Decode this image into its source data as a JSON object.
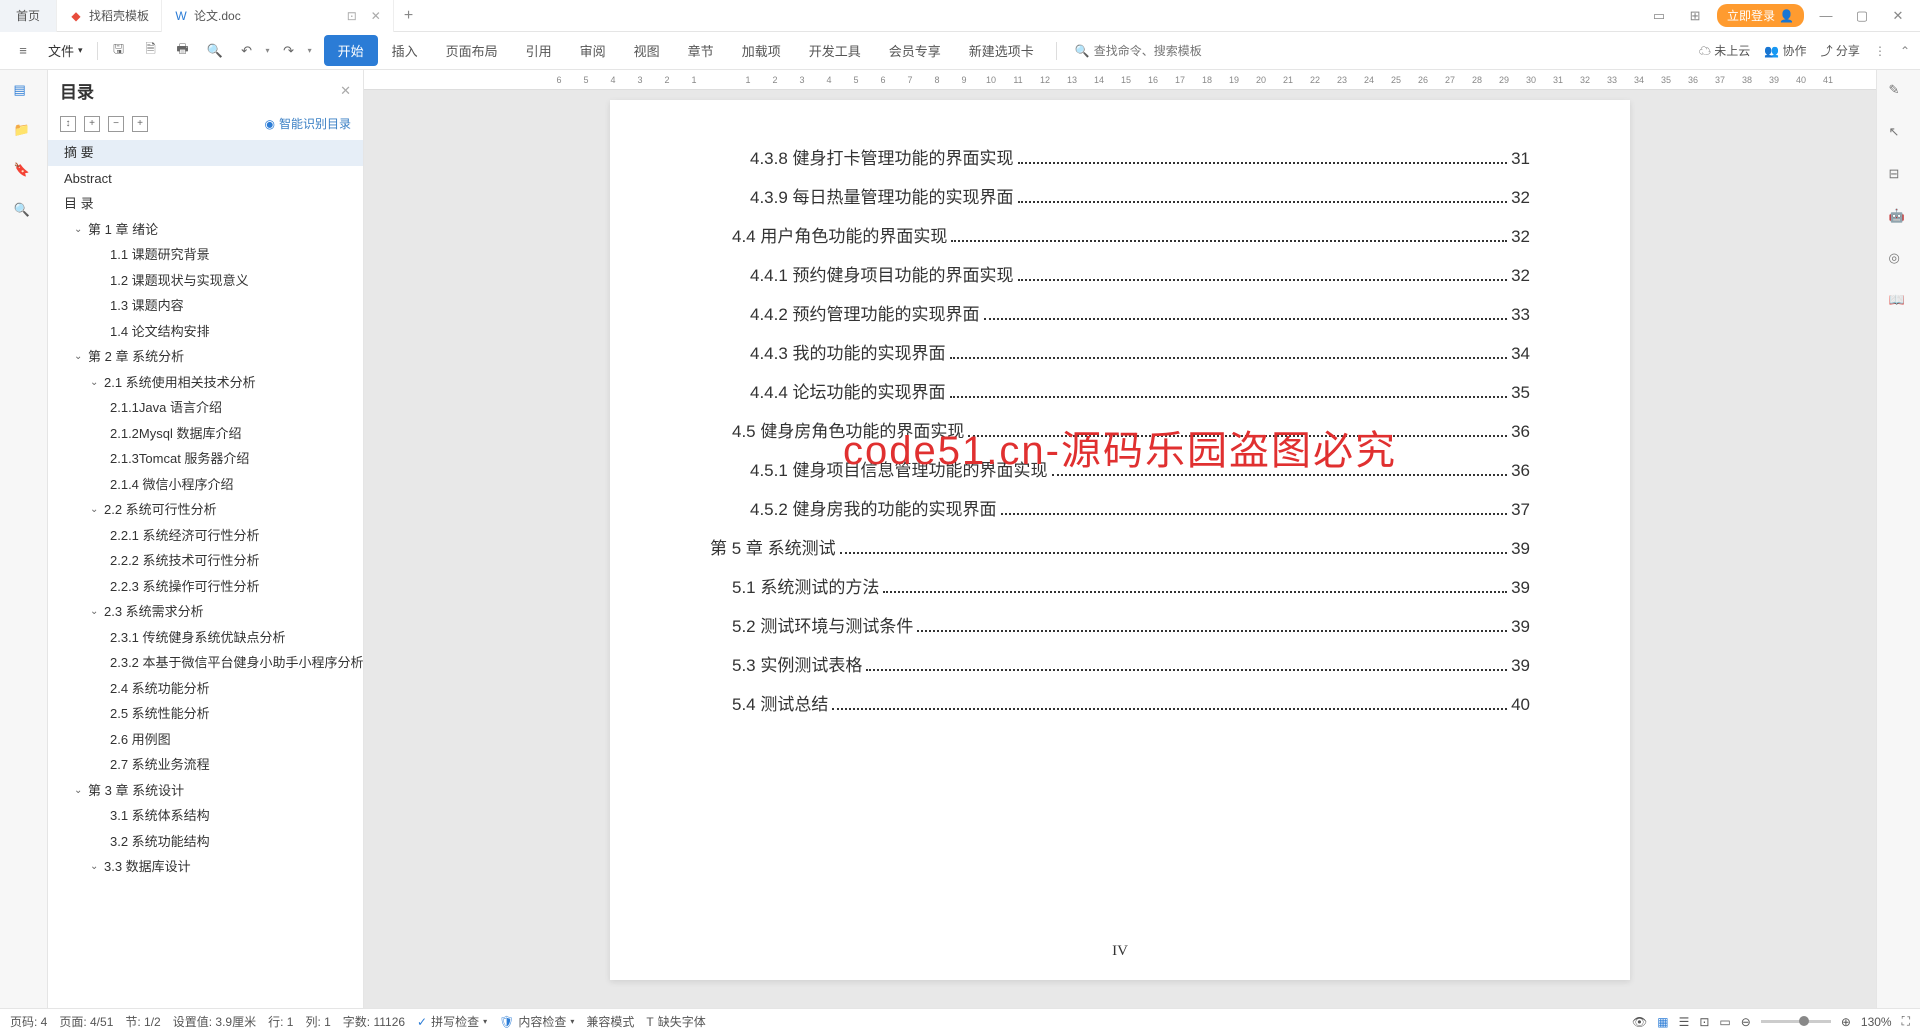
{
  "titlebar": {
    "home": "首页",
    "tab1": "找稻壳模板",
    "tab2": "论文.doc",
    "login": "立即登录"
  },
  "menu": {
    "file": "文件",
    "tabs": [
      "开始",
      "插入",
      "页面布局",
      "引用",
      "审阅",
      "视图",
      "章节",
      "加载项",
      "开发工具",
      "会员专享",
      "新建选项卡"
    ],
    "search_ph": "查找命令、搜索模板",
    "cloud": "未上云",
    "coop": "协作",
    "share": "分享"
  },
  "outline": {
    "title": "目录",
    "smart": "智能识别目录",
    "items": [
      {
        "t": "摘  要",
        "lvl": 0,
        "sel": true
      },
      {
        "t": "Abstract",
        "lvl": 0
      },
      {
        "t": "目 录",
        "lvl": 0
      },
      {
        "t": "第 1 章  绪论",
        "lvl": 1,
        "c": 1
      },
      {
        "t": "1.1 课题研究背景",
        "lvl": 3
      },
      {
        "t": "1.2 课题现状与实现意义",
        "lvl": 3
      },
      {
        "t": "1.3 课题内容",
        "lvl": 3
      },
      {
        "t": "1.4 论文结构安排",
        "lvl": 3
      },
      {
        "t": "第 2 章  系统分析",
        "lvl": 1,
        "c": 1
      },
      {
        "t": "2.1 系统使用相关技术分析",
        "lvl": 2,
        "c": 1
      },
      {
        "t": "2.1.1Java 语言介绍",
        "lvl": 4
      },
      {
        "t": "2.1.2Mysql 数据库介绍",
        "lvl": 4
      },
      {
        "t": "2.1.3Tomcat 服务器介绍",
        "lvl": 4
      },
      {
        "t": "2.1.4 微信小程序介绍",
        "lvl": 4
      },
      {
        "t": "2.2 系统可行性分析",
        "lvl": 2,
        "c": 1
      },
      {
        "t": "2.2.1 系统经济可行性分析",
        "lvl": 4
      },
      {
        "t": "2.2.2 系统技术可行性分析",
        "lvl": 4
      },
      {
        "t": "2.2.3 系统操作可行性分析",
        "lvl": 4
      },
      {
        "t": "2.3 系统需求分析",
        "lvl": 2,
        "c": 1
      },
      {
        "t": "2.3.1 传统健身系统优缺点分析",
        "lvl": 4
      },
      {
        "t": "2.3.2 本基于微信平台健身小助手小程序分析",
        "lvl": 4
      },
      {
        "t": "2.4 系统功能分析",
        "lvl": 3
      },
      {
        "t": "2.5 系统性能分析",
        "lvl": 3
      },
      {
        "t": "2.6 用例图",
        "lvl": 3
      },
      {
        "t": "2.7 系统业务流程",
        "lvl": 3
      },
      {
        "t": "第 3 章  系统设计",
        "lvl": 1,
        "c": 1
      },
      {
        "t": "3.1 系统体系结构",
        "lvl": 3
      },
      {
        "t": "3.2 系统功能结构",
        "lvl": 3
      },
      {
        "t": "3.3 数据库设计",
        "lvl": 2,
        "c": 1
      }
    ]
  },
  "ruler": [
    "6",
    "5",
    "4",
    "3",
    "2",
    "1",
    "",
    "1",
    "2",
    "3",
    "4",
    "5",
    "6",
    "7",
    "8",
    "9",
    "10",
    "11",
    "12",
    "13",
    "14",
    "15",
    "16",
    "17",
    "18",
    "19",
    "20",
    "21",
    "22",
    "23",
    "24",
    "25",
    "26",
    "27",
    "28",
    "29",
    "30",
    "31",
    "32",
    "33",
    "34",
    "35",
    "36",
    "37",
    "38",
    "39",
    "40",
    "41"
  ],
  "toc": [
    {
      "t": "4.3.8 健身打卡管理功能的界面实现",
      "p": "31",
      "l": 3
    },
    {
      "t": "4.3.9 每日热量管理功能的实现界面",
      "p": "32",
      "l": 3
    },
    {
      "t": "4.4 用户角色功能的界面实现",
      "p": "32",
      "l": 2
    },
    {
      "t": "4.4.1 预约健身项目功能的界面实现",
      "p": "32",
      "l": 3
    },
    {
      "t": "4.4.2 预约管理功能的实现界面",
      "p": "33",
      "l": 3
    },
    {
      "t": "4.4.3 我的功能的实现界面",
      "p": "34",
      "l": 3
    },
    {
      "t": "4.4.4 论坛功能的实现界面",
      "p": "35",
      "l": 3
    },
    {
      "t": "4.5 健身房角色功能的界面实现",
      "p": "36",
      "l": 2
    },
    {
      "t": "4.5.1 健身项目信息管理功能的界面实现",
      "p": "36",
      "l": 3
    },
    {
      "t": "4.5.2 健身房我的功能的实现界面",
      "p": "37",
      "l": 3
    },
    {
      "t": "第 5 章  系统测试",
      "p": "39",
      "l": 1
    },
    {
      "t": "5.1 系统测试的方法",
      "p": "39",
      "l": 2
    },
    {
      "t": "5.2 测试环境与测试条件",
      "p": "39",
      "l": 2
    },
    {
      "t": "5.3 实例测试表格",
      "p": "39",
      "l": 2
    },
    {
      "t": "5.4 测试总结",
      "p": "40",
      "l": 2
    }
  ],
  "watermark": "code51.cn-源码乐园盗图必究",
  "pagenum": "IV",
  "status": {
    "page_code": "页码: 4",
    "page": "页面: 4/51",
    "section": "节: 1/2",
    "setval": "设置值: 3.9厘米",
    "row": "行: 1",
    "col": "列: 1",
    "words": "字数: 11126",
    "spell": "拼写检查",
    "content": "内容检查",
    "compat": "兼容模式",
    "missing": "缺失字体",
    "zoom": "130%"
  }
}
